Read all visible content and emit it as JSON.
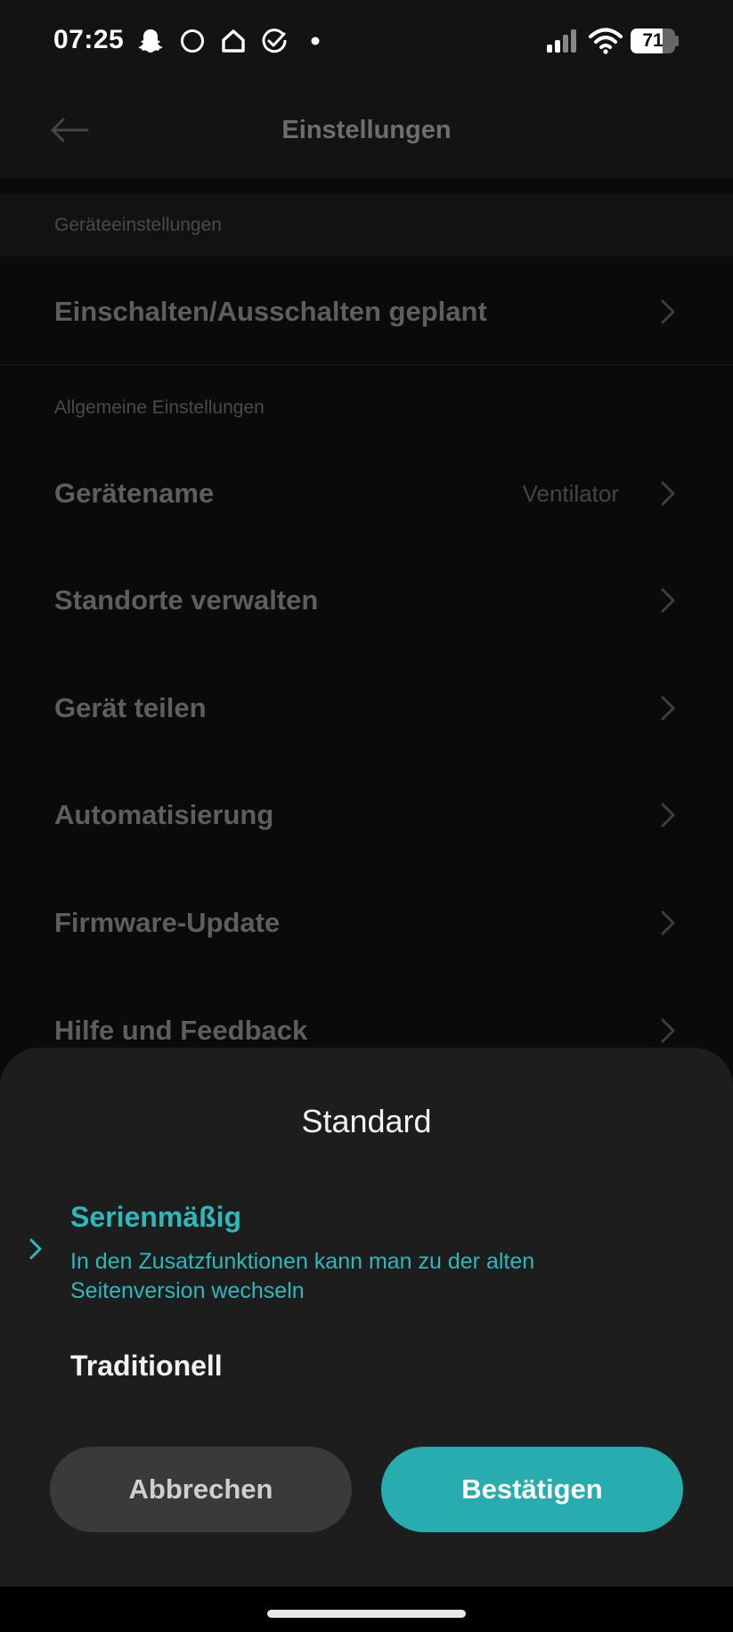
{
  "status_bar": {
    "time": "07:25",
    "icons": [
      "snapchat-icon",
      "circle-icon",
      "home-icon",
      "check-circle-icon",
      "dot-icon",
      "signal-icon",
      "wifi-icon"
    ],
    "battery_percent": "71",
    "battery_level": 0.71
  },
  "header": {
    "title": "Einstellungen",
    "back_icon": "arrow-left-icon"
  },
  "settings": {
    "device_section": "Geräteeinstellungen",
    "scheduled_power": "Einschalten/Ausschalten geplant",
    "general_section": "Allgemeine Einstellungen",
    "device_name": "Gerätename",
    "device_name_value": "Ventilator",
    "manage_locations": "Standorte verwalten",
    "share_device": "Gerät teilen",
    "automation": "Automatisierung",
    "firmware_update": "Firmware-Update",
    "help_feedback": "Hilfe und Feedback",
    "chevron_icon": "chevron-right-icon"
  },
  "sheet": {
    "title": "Standard",
    "selected_option": {
      "label": "Serienmäßig",
      "description": "In den Zusatzfunktionen kann man zu der alten Seitenversion wechseln"
    },
    "other_option": {
      "label": "Traditionell"
    },
    "cancel_label": "Abbrechen",
    "confirm_label": "Bestätigen"
  },
  "colors": {
    "accent": "#27adb0",
    "sheet_background": "#1d1d1d",
    "page_background": "#0a0a0a"
  }
}
